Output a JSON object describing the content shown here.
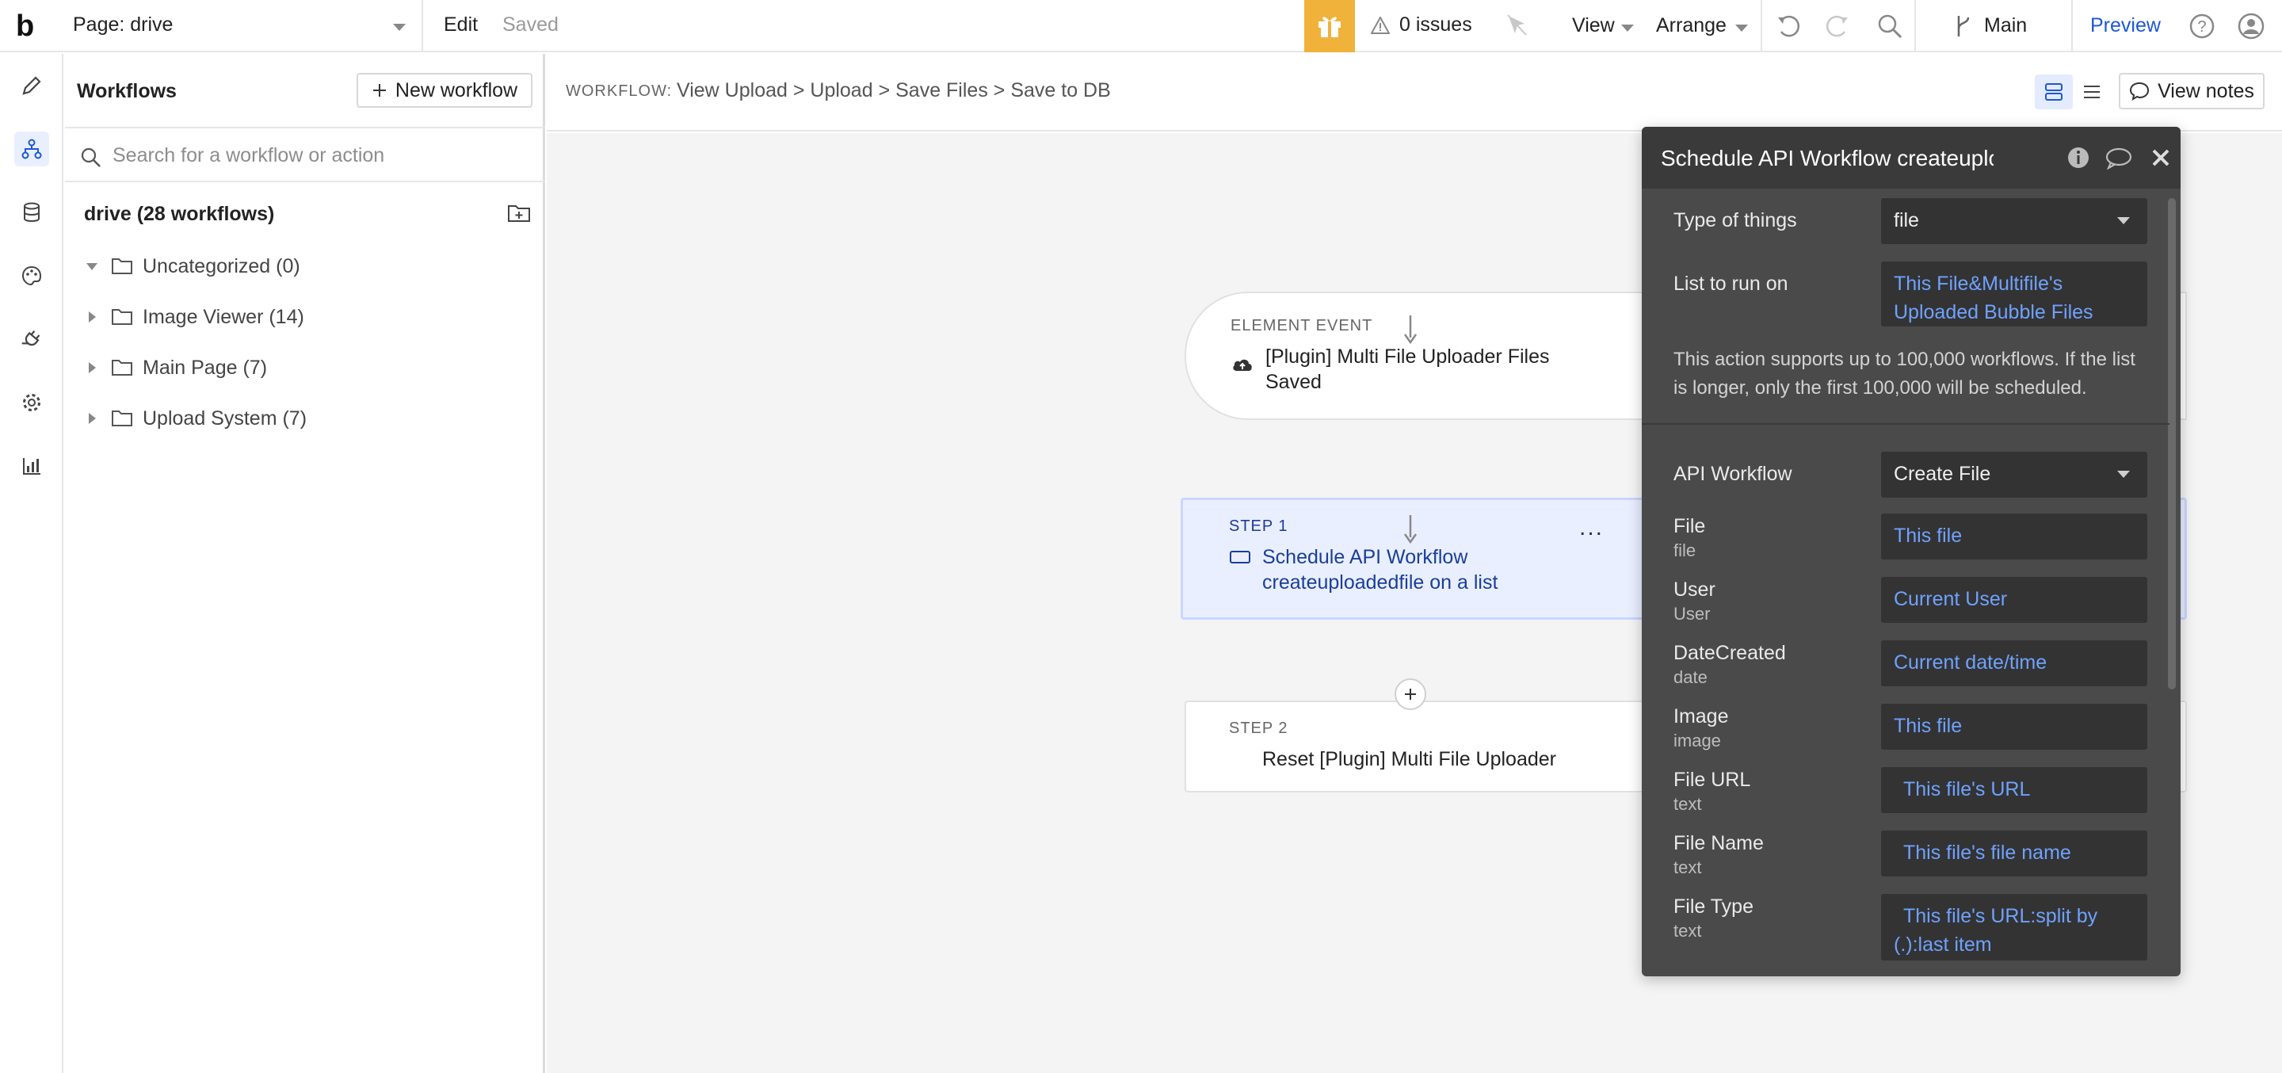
{
  "topbar": {
    "logo": "b",
    "page_label": "Page: drive",
    "edit": "Edit",
    "saved": "Saved",
    "issues": "0 issues",
    "view": "View",
    "arrange": "Arrange",
    "branch": "Main",
    "preview": "Preview"
  },
  "workflows": {
    "title": "Workflows",
    "new_button": "New workflow",
    "search_placeholder": "Search for a workflow or action",
    "app_name": "drive (28 workflows)",
    "folders": [
      {
        "name": "Uncategorized (0)",
        "expanded": true
      },
      {
        "name": "Image Viewer (14)",
        "expanded": false
      },
      {
        "name": "Main Page (7)",
        "expanded": false
      },
      {
        "name": "Upload System (7)",
        "expanded": false
      }
    ]
  },
  "breadcrumb": {
    "label": "WORKFLOW:",
    "path": "View Upload > Upload > Save Files > Save to DB",
    "view_notes": "View notes"
  },
  "canvas": {
    "event": {
      "kicker": "ELEMENT EVENT",
      "line1": "[Plugin] Multi File Uploader Files",
      "line2": "Saved"
    },
    "step1": {
      "kicker": "STEP 1",
      "line1": "Schedule API Workflow",
      "line2": "createuploadedfile on a list",
      "more": "..."
    },
    "step2": {
      "kicker": "STEP 2",
      "text": "Reset [Plugin] Multi File Uploader"
    }
  },
  "editor": {
    "title": "Schedule API Workflow createuploadedfile on a list",
    "type_of_things_label": "Type of things",
    "type_of_things_value": "file",
    "list_label": "List to run on",
    "list_value_1": "This File&Multifile's",
    "list_value_2": "Uploaded Bubble Files",
    "note": "This action supports up to 100,000 workflows. If the list is longer, only the first 100,000 will be scheduled.",
    "api_workflow_label": "API Workflow",
    "api_workflow_value": "Create File",
    "params": [
      {
        "label": "File",
        "type": "file",
        "value": "This file"
      },
      {
        "label": "User",
        "type": "User",
        "value": "Current User"
      },
      {
        "label": "DateCreated",
        "type": "date",
        "value": "Current date/time"
      },
      {
        "label": "Image",
        "type": "image",
        "value": "This file"
      },
      {
        "label": "File URL",
        "type": "text",
        "value": "This file's URL"
      },
      {
        "label": "File Name",
        "type": "text",
        "value": "This file's file name"
      },
      {
        "label": "File Type",
        "type": "text",
        "value_1": "This file's URL:split by",
        "value_2": "(.):last item"
      }
    ]
  },
  "colors": {
    "accent": "#1d58d6",
    "gift": "#f0b23b",
    "editor_bg": "#4a4a4a",
    "dynamic_value": "#6fa2ff"
  }
}
